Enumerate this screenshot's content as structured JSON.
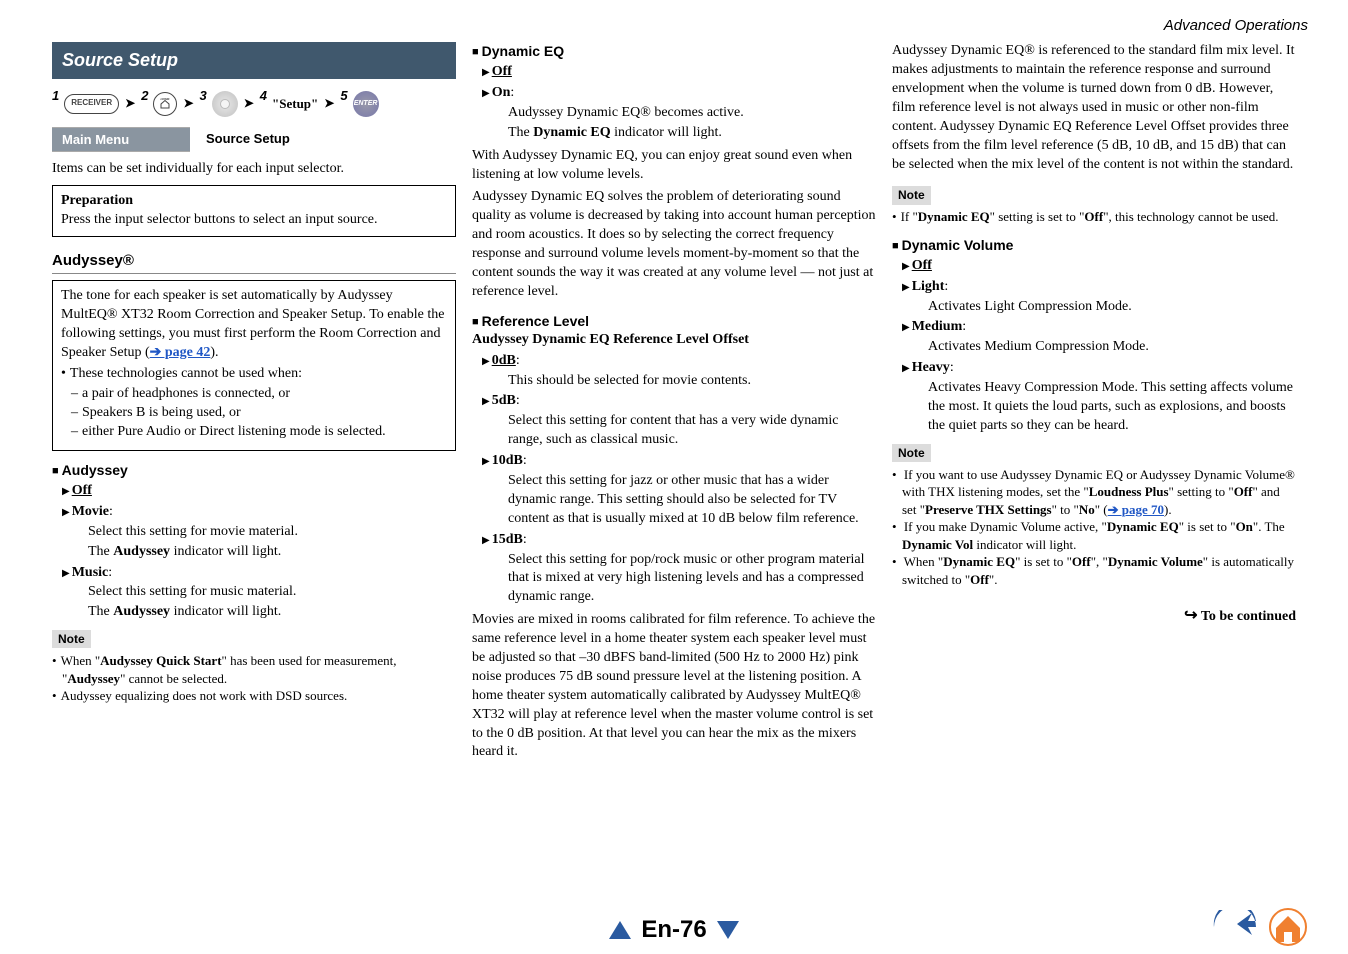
{
  "header": {
    "section": "Advanced Operations"
  },
  "col1": {
    "banner": "Source Setup",
    "steps": {
      "s1": "1",
      "s2": "2",
      "s3": "3",
      "s4": "4",
      "setup": "\"Setup\"",
      "s5": "5",
      "receiver": "RECEIVER",
      "home": "HOME",
      "enter": "ENTER"
    },
    "menubar": {
      "main": "Main Menu",
      "sel": "Source Setup"
    },
    "intro": "Items can be set individually for each input selector.",
    "prep_h": "Preparation",
    "prep_b": "Press the input selector buttons to select an input source.",
    "aud_h": "Audyssey®",
    "aud_box_p1": "The tone for each speaker is set automatically by Audyssey MultEQ® XT32 Room Correction and Speaker Setup. To enable the following settings, you must first perform the Room Correction and Speaker Setup (",
    "aud_box_link": "➔ page 42",
    "aud_box_p1b": ").",
    "aud_box_li0": "These technologies cannot be used when:",
    "aud_box_sub1": "a pair of headphones is connected, or",
    "aud_box_sub2": "Speakers B is being used, or",
    "aud_box_sub3": "either Pure Audio or Direct listening mode is selected.",
    "aud_sub_h": "Audyssey",
    "aud_opts": {
      "off": "Off",
      "movie": "Movie",
      "movie_d1": "Select this setting for movie material.",
      "movie_d2a": "The ",
      "movie_d2b": "Audyssey",
      "movie_d2c": " indicator will light.",
      "music": "Music",
      "music_d1": "Select this setting for music material.",
      "music_d2a": "The ",
      "music_d2b": "Audyssey",
      "music_d2c": " indicator will light."
    },
    "note_tag": "Note",
    "note1a": "When \"",
    "note1b": "Audyssey Quick Start",
    "note1c": "\" has been used for measurement, \"",
    "note1d": "Audyssey",
    "note1e": "\" cannot be selected.",
    "note2": "Audyssey equalizing does not work with DSD sources."
  },
  "col2": {
    "deq_h": "Dynamic EQ",
    "deq_off": "Off",
    "deq_on": "On",
    "deq_on_d1": "Audyssey Dynamic EQ® becomes active.",
    "deq_on_d2a": "The ",
    "deq_on_d2b": "Dynamic EQ",
    "deq_on_d2c": " indicator will light.",
    "deq_p1": "With Audyssey Dynamic EQ, you can enjoy great sound even when listening at low volume levels.",
    "deq_p2": "Audyssey Dynamic EQ solves the problem of deteriorating sound quality as volume is decreased by taking into account human perception and room acoustics. It does so by selecting the correct frequency response and surround volume levels moment-by-moment so that the content sounds the way it was created at any volume level — not just at reference level.",
    "ref_h": "Reference Level",
    "ref_sub": "Audyssey Dynamic EQ Reference Level Offset",
    "r0": "0dB",
    "r0d": "This should be selected for movie contents.",
    "r5": "5dB",
    "r5d": "Select this setting for content that has a very wide dynamic range, such as classical music.",
    "r10": "10dB",
    "r10d": "Select this setting for jazz or other music that has a wider dynamic range. This setting should also be selected for TV content as that is usually mixed at 10 dB below film reference.",
    "r15": "15dB",
    "r15d": "Select this setting for pop/rock music or other program material that is mixed at very high listening levels and has a compressed dynamic range.",
    "ref_para": "Movies are mixed in rooms calibrated for film reference. To achieve the same reference level in a home theater system each speaker level must be adjusted so that –30 dBFS band-limited (500 Hz to 2000 Hz) pink noise produces 75 dB sound pressure level at the listening position. A home theater system automatically calibrated by Audyssey MultEQ® XT32 will play at reference level when the master volume control is set to the 0 dB position. At that level you can hear the mix as the mixers heard it."
  },
  "col3": {
    "para": "Audyssey Dynamic EQ® is referenced to the standard film mix level. It makes adjustments to maintain the reference response and surround envelopment when the volume is turned down from 0 dB. However, film reference level is not always used in music or other non-film content. Audyssey Dynamic EQ Reference Level Offset provides three offsets from the film level reference (5 dB, 10 dB, and 15 dB) that can be selected when the mix level of the content is not within the standard.",
    "note_tag": "Note",
    "note1a": "If \"",
    "note1b": "Dynamic EQ",
    "note1c": "\" setting is set to \"",
    "note1d": "Off",
    "note1e": "\", this technology cannot be used.",
    "dv_h": "Dynamic Volume",
    "dv_off": "Off",
    "dv_light": "Light",
    "dv_light_d": "Activates Light Compression Mode.",
    "dv_med": "Medium",
    "dv_med_d": "Activates Medium Compression Mode.",
    "dv_heavy": "Heavy",
    "dv_heavy_d": "Activates Heavy Compression Mode. This setting affects volume the most. It quiets the loud parts, such as explosions, and boosts the quiet parts so they can be heard.",
    "note2_tag": "Note",
    "n2_1a": "If you want to use Audyssey Dynamic EQ or Audyssey Dynamic Volume® with THX listening modes, set the \"",
    "n2_1b": "Loudness Plus",
    "n2_1c": "\" setting to \"",
    "n2_1d": "Off",
    "n2_1e": "\" and set \"",
    "n2_1f": "Preserve THX Settings",
    "n2_1g": "\" to \"",
    "n2_1h": "No",
    "n2_1i": "\" (",
    "n2_1link": "➔ page 70",
    "n2_1j": ").",
    "n2_2a": "If you make Dynamic Volume active, \"",
    "n2_2b": "Dynamic EQ",
    "n2_2c": "\" is set to \"",
    "n2_2d": "On",
    "n2_2e": "\". The ",
    "n2_2f": "Dynamic Vol",
    "n2_2g": " indicator will light.",
    "n2_3a": "When \"",
    "n2_3b": "Dynamic EQ",
    "n2_3c": "\" is set to \"",
    "n2_3d": "Off",
    "n2_3e": "\", \"",
    "n2_3f": "Dynamic Volume",
    "n2_3g": "\" is automatically switched to \"",
    "n2_3h": "Off",
    "n2_3i": "\".",
    "cont": "To be continued"
  },
  "footer": {
    "page": "En-76"
  }
}
